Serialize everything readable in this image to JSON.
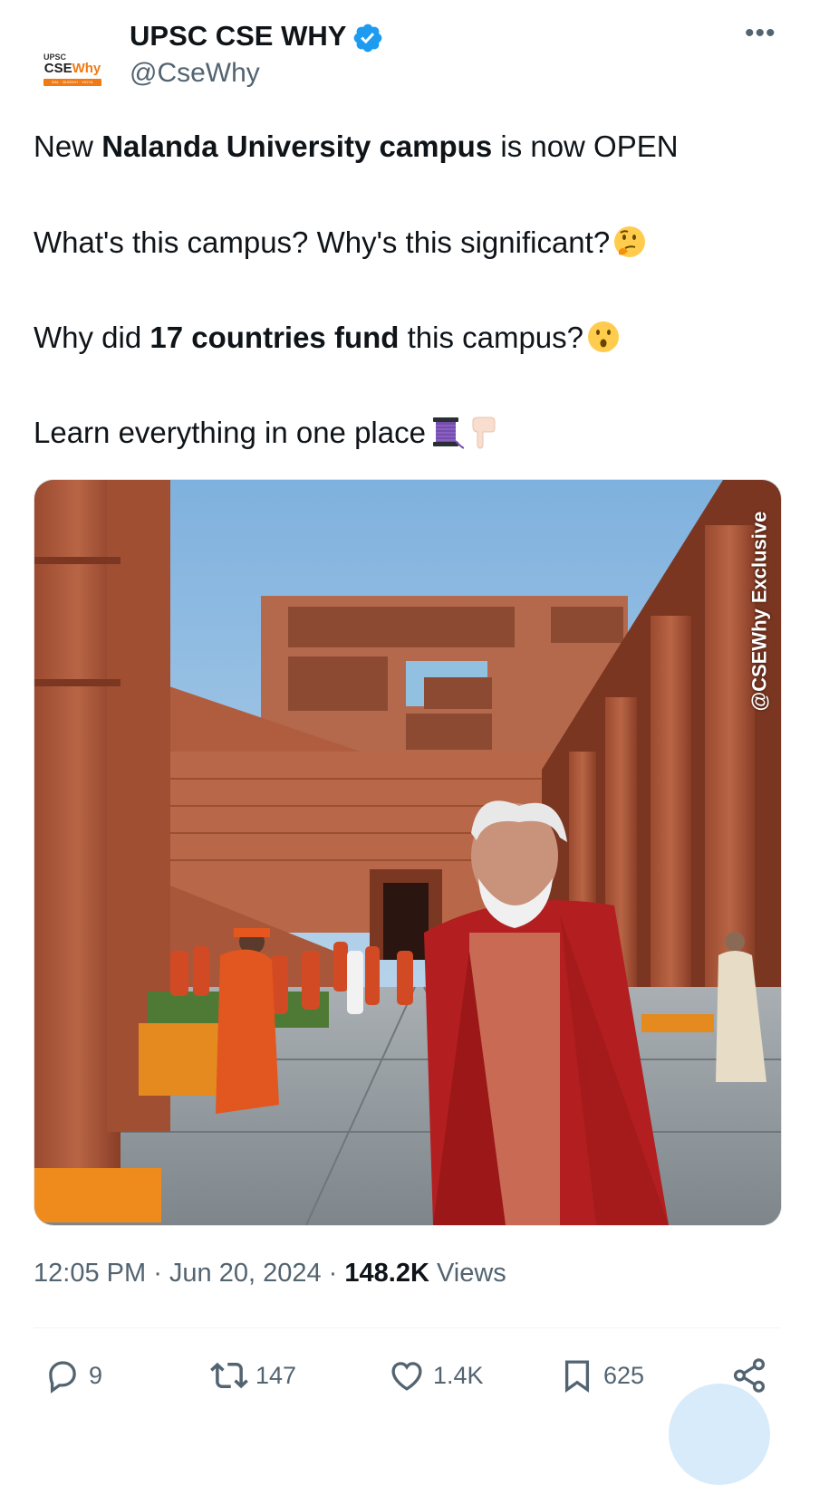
{
  "account": {
    "display_name": "UPSC CSE WHY",
    "handle": "@CseWhy",
    "avatar": {
      "line1": "UPSC",
      "line2_a": "CSE",
      "line2_b": "Why",
      "tagline": "BAL · BUDDHI · VIDYA"
    },
    "verified_icon": "verified-badge-icon",
    "more_label": "•••"
  },
  "tweet": {
    "p1": {
      "a": "New ",
      "b": "Nalanda University campus",
      "c": " is now OPEN"
    },
    "p2": {
      "a": "What's this campus? Why's this significant?"
    },
    "p3": {
      "a": "Why did ",
      "b": "17 countries fund",
      "c": " this campus?"
    },
    "p4": {
      "a": "Learn everything in one place"
    },
    "emojis": [
      "thinking-face",
      "hushed-face",
      "thread-spool",
      "backhand-index-down"
    ]
  },
  "image": {
    "watermark": "@CSEWhy Exclusive"
  },
  "meta": {
    "time": "12:05 PM",
    "sep1": " · ",
    "date": "Jun 20, 2024",
    "sep2": " · ",
    "views_count": "148.2K",
    "views_label": " Views"
  },
  "actions": {
    "replies": "9",
    "retweets": "147",
    "likes": "1.4K",
    "bookmarks": "625"
  },
  "colors": {
    "text": "#0f1419",
    "secondary": "#536471",
    "verified": "#1d9bf0",
    "brand_orange": "#f07a14"
  }
}
